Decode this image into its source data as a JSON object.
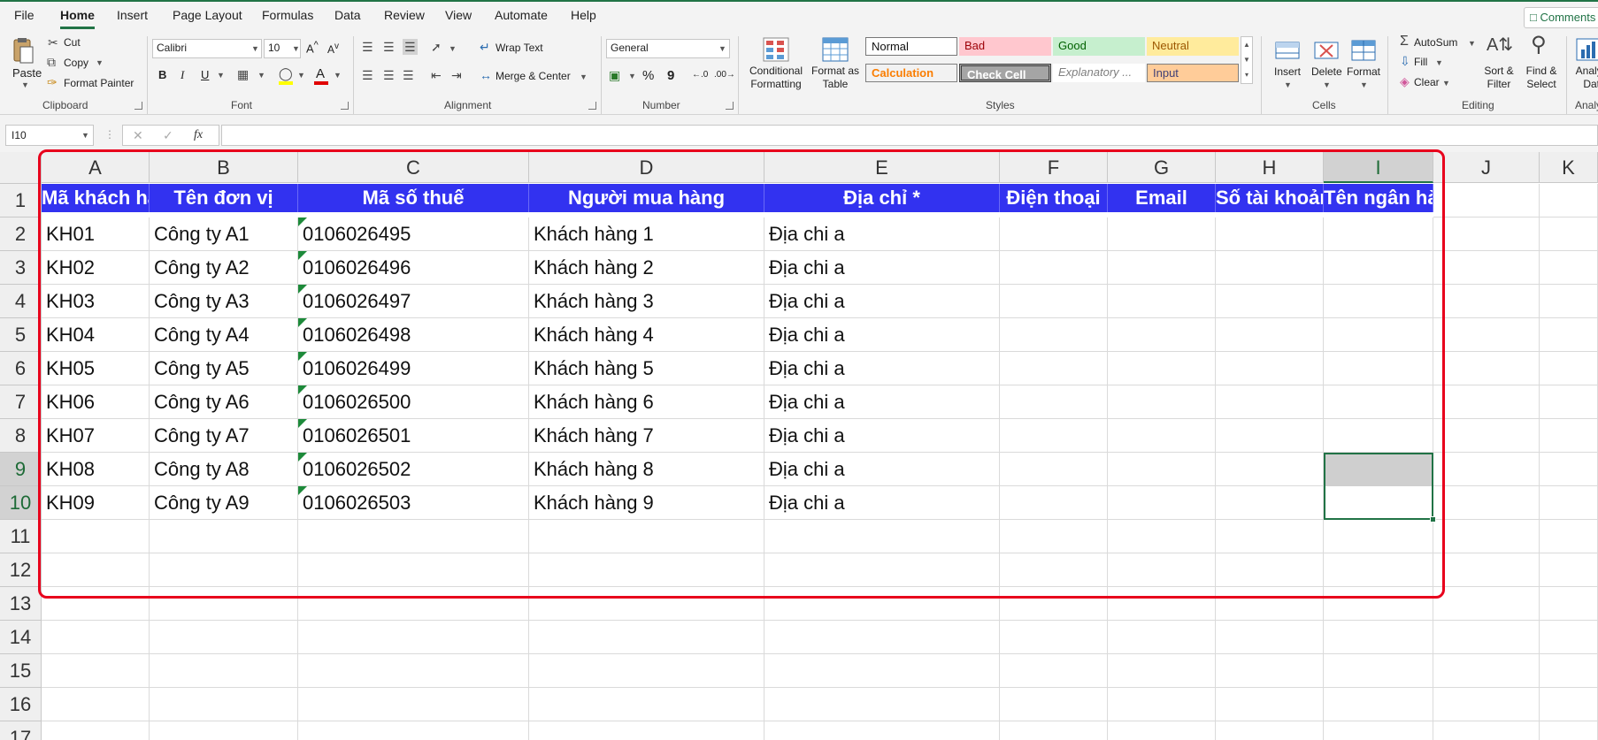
{
  "menu": {
    "items": [
      {
        "label": "File",
        "active": false
      },
      {
        "label": "Home",
        "active": true
      },
      {
        "label": "Insert",
        "active": false
      },
      {
        "label": "Page Layout",
        "active": false
      },
      {
        "label": "Formulas",
        "active": false
      },
      {
        "label": "Data",
        "active": false
      },
      {
        "label": "Review",
        "active": false
      },
      {
        "label": "View",
        "active": false
      },
      {
        "label": "Automate",
        "active": false
      },
      {
        "label": "Help",
        "active": false
      }
    ],
    "comments_label": "Comments"
  },
  "ribbon": {
    "clipboard": {
      "paste": "Paste",
      "cut": "Cut",
      "copy": "Copy",
      "format_painter": "Format Painter",
      "group": "Clipboard"
    },
    "font": {
      "name": "Calibri",
      "size": "10",
      "group": "Font",
      "bold": "B",
      "italic": "I",
      "underline": "U"
    },
    "alignment": {
      "wrap": "Wrap Text",
      "merge": "Merge & Center",
      "group": "Alignment"
    },
    "number": {
      "format": "General",
      "percent": "%",
      "comma": "9",
      "group": "Number"
    },
    "styles": {
      "conditional": "Conditional Formatting",
      "format_table": "Format as Table",
      "group": "Styles",
      "cells": [
        {
          "label": "Normal",
          "bg": "#ffffff",
          "fg": "#111111"
        },
        {
          "label": "Bad",
          "bg": "#ffc7ce",
          "fg": "#9c0006"
        },
        {
          "label": "Good",
          "bg": "#c6efce",
          "fg": "#006100"
        },
        {
          "label": "Neutral",
          "bg": "#ffeb9c",
          "fg": "#9c5700"
        },
        {
          "label": "Calculation",
          "bg": "#f2f2f2",
          "fg": "#fa7d00"
        },
        {
          "label": "Check Cell",
          "bg": "#a5a5a5",
          "fg": "#ffffff"
        },
        {
          "label": "Explanatory ...",
          "bg": "#ffffff",
          "fg": "#7f7f7f"
        },
        {
          "label": "Input",
          "bg": "#ffcc99",
          "fg": "#3f3f76"
        }
      ]
    },
    "cells": {
      "insert": "Insert",
      "delete": "Delete",
      "format": "Format",
      "group": "Cells"
    },
    "editing": {
      "autosum": "AutoSum",
      "fill": "Fill",
      "clear": "Clear",
      "sort": "Sort & Filter",
      "find": "Find & Select",
      "group": "Editing"
    },
    "analyze": "Analyze Data",
    "analyze_group": "Analysis"
  },
  "formula_bar": {
    "name_box": "I10",
    "fx": "fx",
    "value": ""
  },
  "sheet": {
    "columns": [
      "A",
      "B",
      "C",
      "D",
      "E",
      "F",
      "G",
      "H",
      "I",
      "J",
      "K"
    ],
    "selected_column": "I",
    "rows": [
      "1",
      "2",
      "3",
      "4",
      "5",
      "6",
      "7",
      "8",
      "9",
      "10",
      "11",
      "12",
      "13",
      "14",
      "15",
      "16",
      "17"
    ],
    "selected_rows": [
      "9",
      "10"
    ],
    "header_fill": "#3232f0",
    "headers": [
      "Mã khách hàng",
      "Tên đơn vị",
      "Mã số thuế",
      "Người mua hàng",
      "Địa chỉ *",
      "Điện thoại",
      "Email",
      "Số tài khoản",
      "Tên ngân hàng"
    ],
    "data": [
      [
        "KH01",
        "Công ty A1",
        "0106026495",
        "Khách hàng 1",
        "Địa chi a"
      ],
      [
        "KH02",
        "Công ty A2",
        "0106026496",
        "Khách hàng 2",
        "Địa chi a"
      ],
      [
        "KH03",
        "Công ty A3",
        "0106026497",
        "Khách hàng 3",
        "Địa chi a"
      ],
      [
        "KH04",
        "Công ty A4",
        "0106026498",
        "Khách hàng 4",
        "Địa chi a"
      ],
      [
        "KH05",
        "Công ty A5",
        "0106026499",
        "Khách hàng 5",
        "Địa chi a"
      ],
      [
        "KH06",
        "Công ty A6",
        "0106026500",
        "Khách hàng 6",
        "Địa chi a"
      ],
      [
        "KH07",
        "Công ty A7",
        "0106026501",
        "Khách hàng 7",
        "Địa chi a"
      ],
      [
        "KH08",
        "Công ty A8",
        "0106026502",
        "Khách hàng 8",
        "Địa chi a"
      ],
      [
        "KH09",
        "Công ty A9",
        "0106026503",
        "Khách hàng 9",
        "Địa chi a"
      ]
    ]
  }
}
